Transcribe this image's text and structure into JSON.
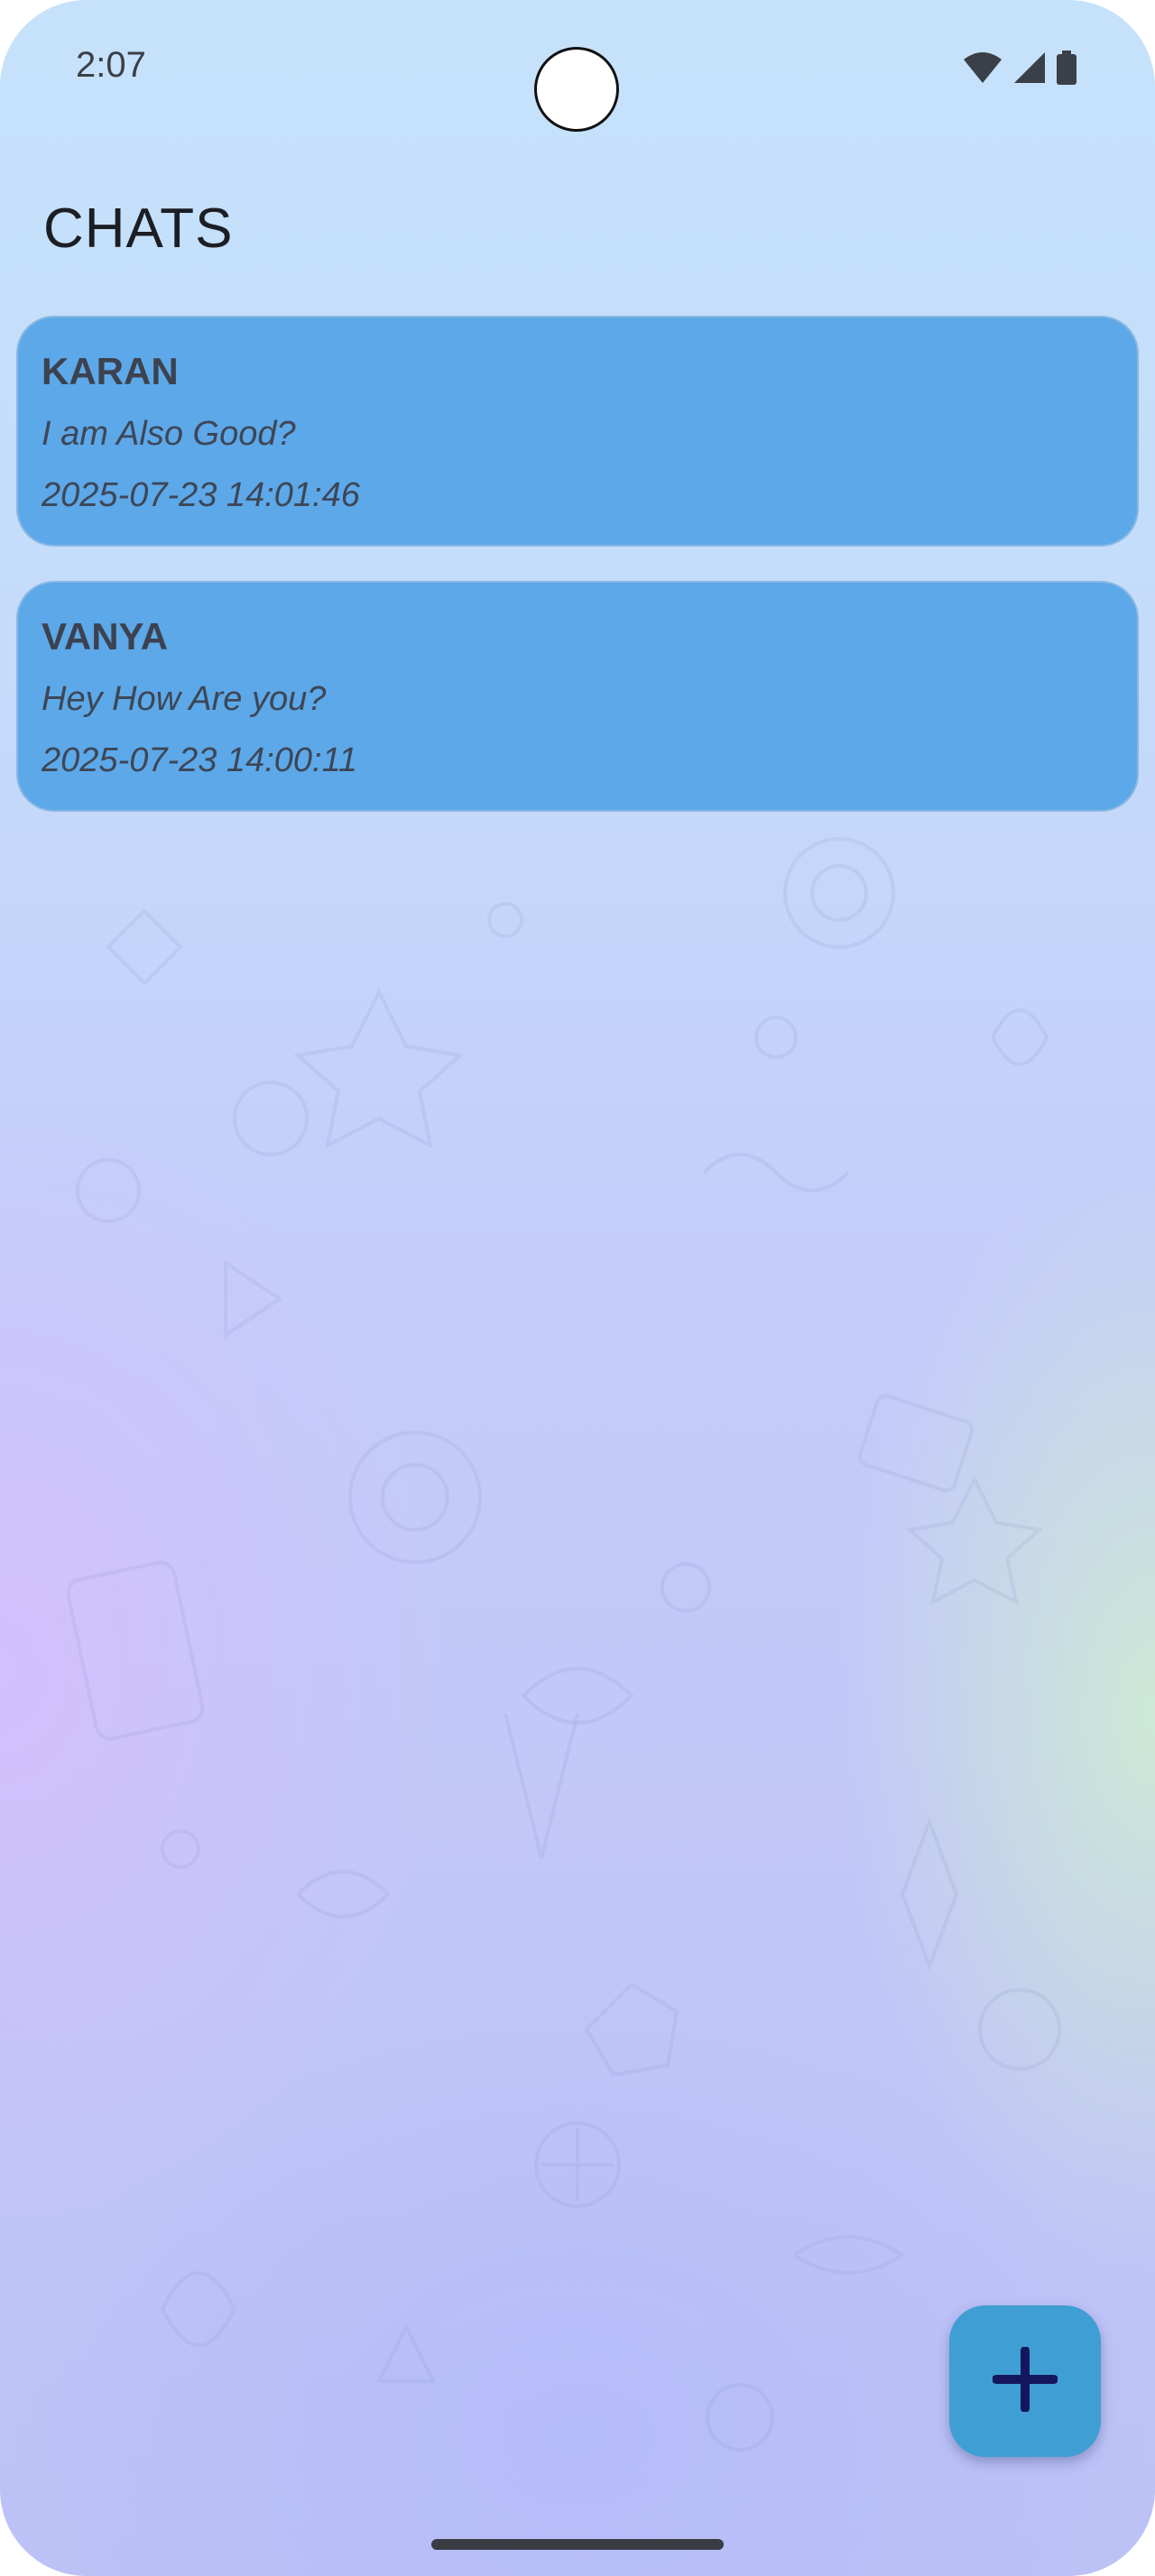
{
  "status_bar": {
    "time": "2:07",
    "icons": [
      "wifi-icon",
      "cell-signal-icon",
      "battery-icon"
    ]
  },
  "header": {
    "title": "CHATS"
  },
  "chats": [
    {
      "name": "KARAN",
      "last_message": "I am Also Good?",
      "timestamp": "2025-07-23 14:01:46"
    },
    {
      "name": "VANYA",
      "last_message": "Hey How Are you?",
      "timestamp": "2025-07-23 14:00:11"
    }
  ],
  "fab": {
    "icon": "plus-icon"
  },
  "colors": {
    "card_background": "#5da8e8",
    "fab_background": "#3f9ed3",
    "fab_icon": "#14165e"
  }
}
